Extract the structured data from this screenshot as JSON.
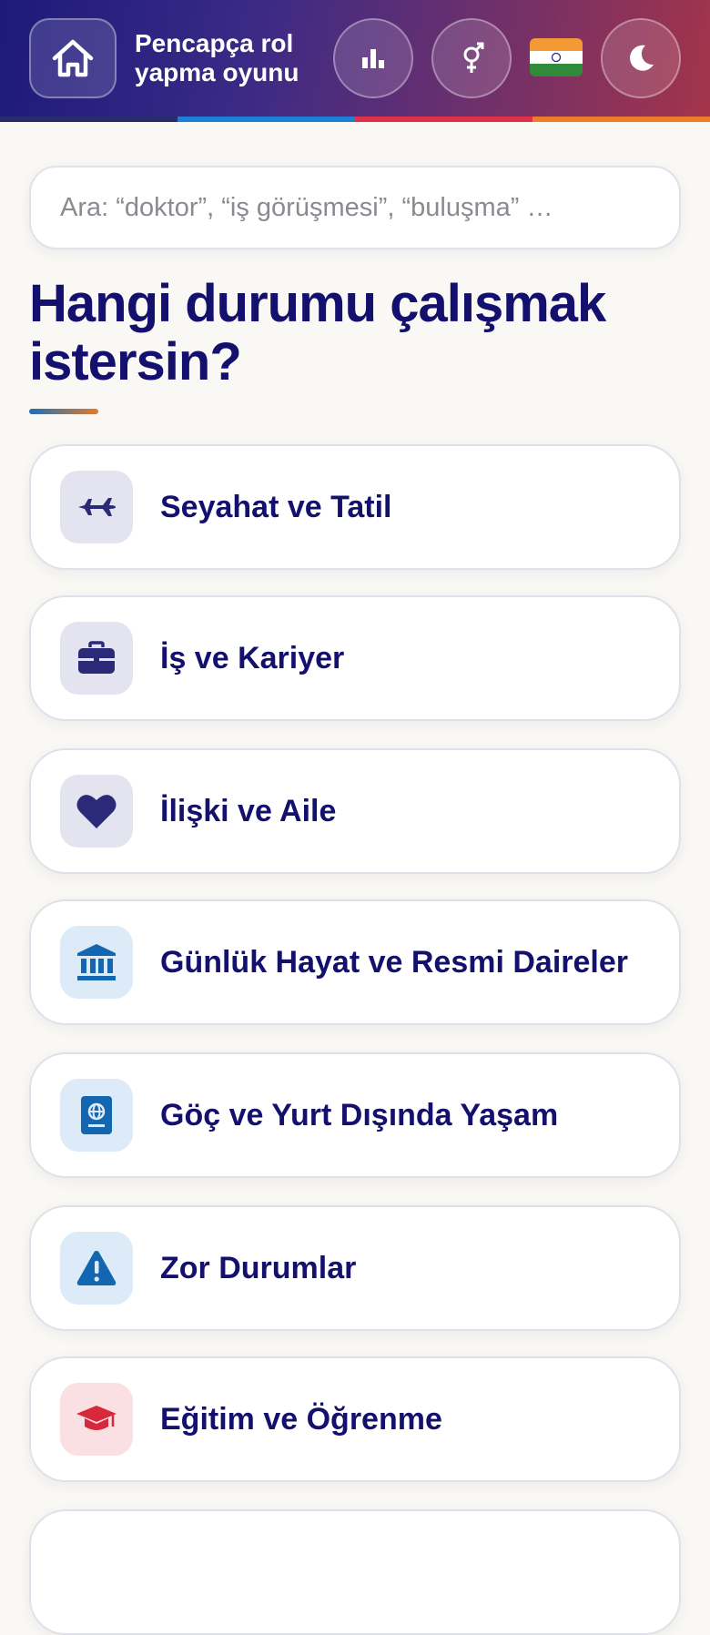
{
  "header": {
    "title_line1": "Pencapça rol",
    "title_line2": "yapma oyunu",
    "stripe_colors": [
      "#2a2a6e",
      "#1e7fd6",
      "#e0304a",
      "#f07c2a"
    ]
  },
  "search": {
    "placeholder": "Ara: “doktor”, “iş görüşmesi”, “buluşma” …",
    "value": ""
  },
  "main": {
    "heading": "Hangi durumu çalışmak istersin?"
  },
  "categories": [
    {
      "label": "Seyahat ve Tatil",
      "icon": "airplane-icon",
      "icon_bg": "#e4e3f0",
      "icon_color": "#2a2a78"
    },
    {
      "label": "İş ve Kariyer",
      "icon": "briefcase-icon",
      "icon_bg": "#e4e3f0",
      "icon_color": "#2a2a78"
    },
    {
      "label": "İlişki ve Aile",
      "icon": "heart-icon",
      "icon_bg": "#e4e3f0",
      "icon_color": "#2a2a78"
    },
    {
      "label": "Günlük Hayat ve Resmi Daireler",
      "icon": "government-building-icon",
      "icon_bg": "#dcebf7",
      "icon_color": "#1566b0"
    },
    {
      "label": "Göç ve Yurt Dışında Yaşam",
      "icon": "passport-icon",
      "icon_bg": "#dcebf7",
      "icon_color": "#1566b0"
    },
    {
      "label": "Zor Durumlar",
      "icon": "warning-icon",
      "icon_bg": "#dcebf7",
      "icon_color": "#1566b0"
    },
    {
      "label": "Eğitim ve Öğrenme",
      "icon": "graduation-cap-icon",
      "icon_bg": "#fbe0e3",
      "icon_color": "#d8283c"
    },
    {
      "label": "",
      "icon": "",
      "icon_bg": "#ffffff",
      "icon_color": "#ffffff"
    }
  ]
}
